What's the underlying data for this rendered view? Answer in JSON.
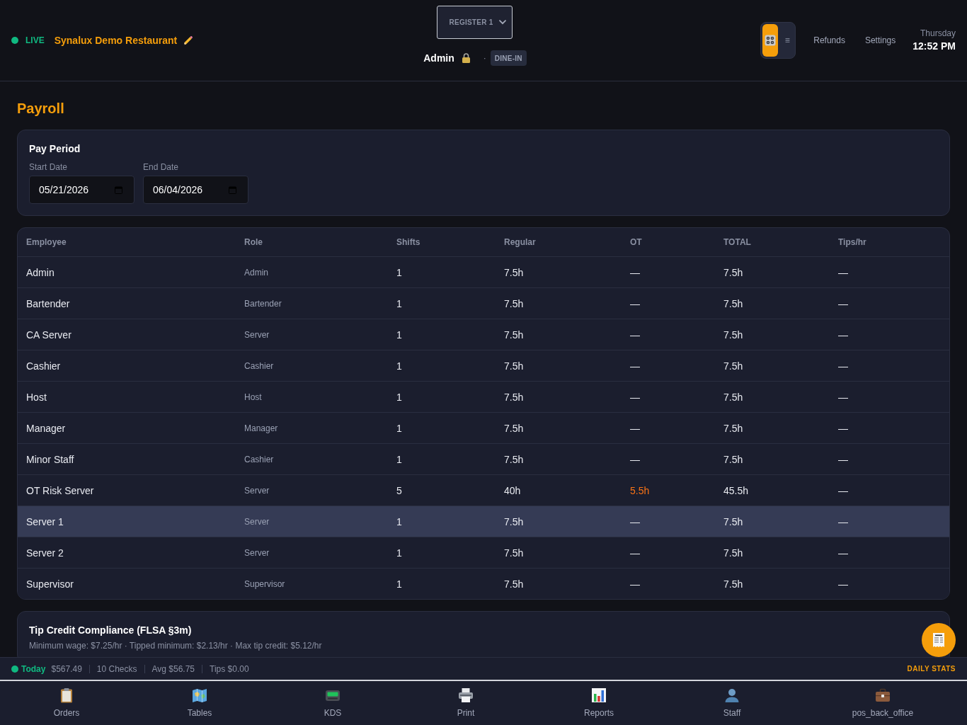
{
  "header": {
    "status_label": "LIVE",
    "restaurant_name": "Synalux Demo Restaurant",
    "register_select": {
      "value": "REGISTER 1"
    },
    "user": "Admin",
    "separator": "·",
    "order_type_badge": "DINE-IN",
    "view_toggle": [
      {
        "kind": "grid",
        "selected": true
      },
      {
        "kind": "list",
        "label": "≡",
        "selected": false
      }
    ],
    "links": [
      "Refunds",
      "Settings"
    ],
    "day": "Thursday",
    "time": "12:52 PM"
  },
  "page_title": "Payroll",
  "pay_period": {
    "title": "Pay Period",
    "fields": [
      {
        "label": "Start Date",
        "value": "05/21/2026"
      },
      {
        "label": "End Date",
        "value": "06/04/2026"
      }
    ]
  },
  "table": {
    "columns": [
      "Employee",
      "Role",
      "Shifts",
      "Regular",
      "OT",
      "TOTAL",
      "Tips/hr"
    ],
    "rows": [
      {
        "cells": [
          "Admin",
          "Admin",
          "1",
          "7.5h",
          "—",
          "7.5h",
          "—"
        ],
        "overtime": false,
        "selected": false
      },
      {
        "cells": [
          "Bartender",
          "Bartender",
          "1",
          "7.5h",
          "—",
          "7.5h",
          "—"
        ],
        "overtime": false,
        "selected": false
      },
      {
        "cells": [
          "CA Server",
          "Server",
          "1",
          "7.5h",
          "—",
          "7.5h",
          "—"
        ],
        "overtime": false,
        "selected": false
      },
      {
        "cells": [
          "Cashier",
          "Cashier",
          "1",
          "7.5h",
          "—",
          "7.5h",
          "—"
        ],
        "overtime": false,
        "selected": false
      },
      {
        "cells": [
          "Host",
          "Host",
          "1",
          "7.5h",
          "—",
          "7.5h",
          "—"
        ],
        "overtime": false,
        "selected": false
      },
      {
        "cells": [
          "Manager",
          "Manager",
          "1",
          "7.5h",
          "—",
          "7.5h",
          "—"
        ],
        "overtime": false,
        "selected": false
      },
      {
        "cells": [
          "Minor Staff",
          "Cashier",
          "1",
          "7.5h",
          "—",
          "7.5h",
          "—"
        ],
        "overtime": false,
        "selected": false
      },
      {
        "cells": [
          "OT Risk Server",
          "Server",
          "5",
          "40h",
          "5.5h",
          "45.5h",
          "—"
        ],
        "overtime": true,
        "selected": false
      },
      {
        "cells": [
          "Server 1",
          "Server",
          "1",
          "7.5h",
          "—",
          "7.5h",
          "—"
        ],
        "overtime": false,
        "selected": true
      },
      {
        "cells": [
          "Server 2",
          "Server",
          "1",
          "7.5h",
          "—",
          "7.5h",
          "—"
        ],
        "overtime": false,
        "selected": false
      },
      {
        "cells": [
          "Supervisor",
          "Supervisor",
          "1",
          "7.5h",
          "—",
          "7.5h",
          "—"
        ],
        "overtime": false,
        "selected": false
      }
    ]
  },
  "tip_credit": {
    "title": "Tip Credit Compliance (FLSA §3m)",
    "subtitle": "Minimum wage: $7.25/hr · Tipped minimum: $2.13/hr · Max tip credit: $5.12/hr"
  },
  "status_bar": {
    "label": "Today",
    "items": [
      "$567.49",
      "10 Checks",
      "Avg $56.75",
      "Tips $0.00"
    ],
    "daily_stats": "DAILY STATS"
  },
  "nav": [
    {
      "kind": "clipboard",
      "label": "Orders"
    },
    {
      "kind": "map",
      "label": "Tables"
    },
    {
      "kind": "pager",
      "label": "KDS"
    },
    {
      "kind": "printer",
      "label": "Print"
    },
    {
      "kind": "chart",
      "label": "Reports"
    },
    {
      "kind": "person",
      "label": "Staff"
    },
    {
      "kind": "briefcase",
      "label": "pos_back_office"
    }
  ]
}
